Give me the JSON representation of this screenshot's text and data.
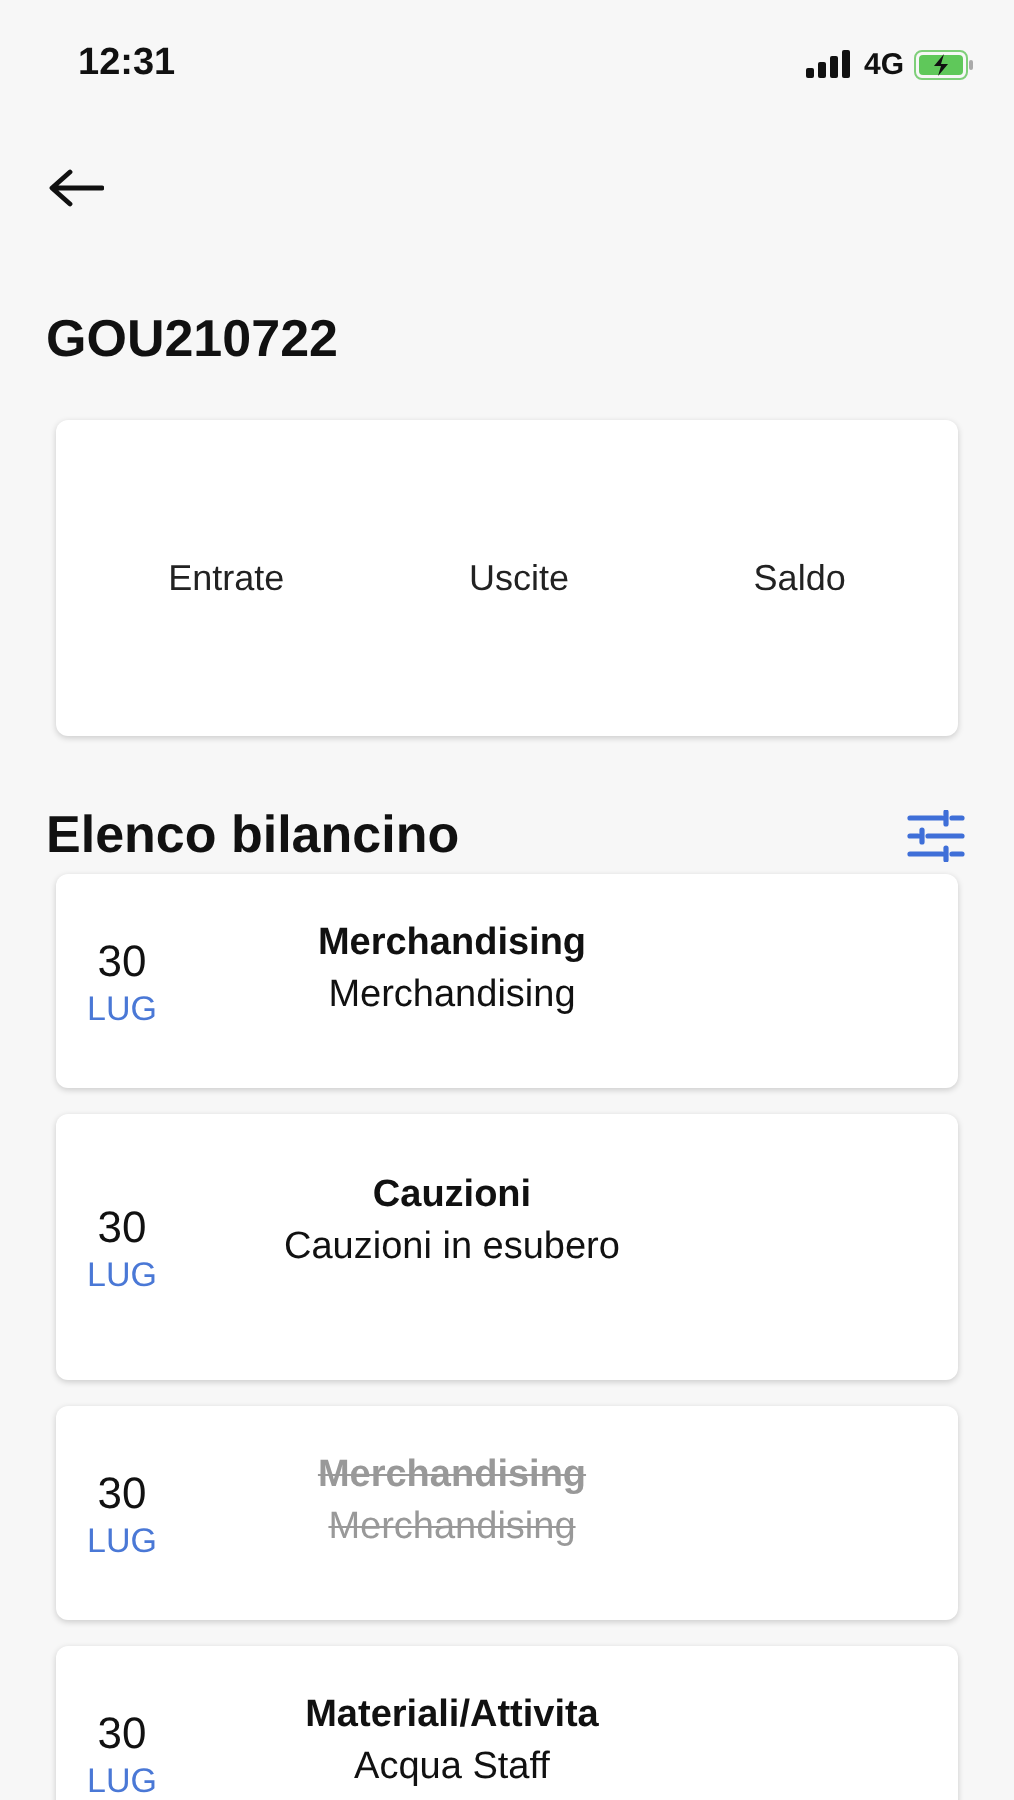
{
  "status_bar": {
    "time": "12:31",
    "network": "4G"
  },
  "title": "GOU210722",
  "summary": {
    "labels": [
      "Entrate",
      "Uscite",
      "Saldo"
    ]
  },
  "list": {
    "title": "Elenco bilancino",
    "items": [
      {
        "day": "30",
        "month": "LUG",
        "category": "Merchandising",
        "description": "Merchandising",
        "cancelled": false
      },
      {
        "day": "30",
        "month": "LUG",
        "category": "Cauzioni",
        "description": "Cauzioni in esubero",
        "cancelled": false
      },
      {
        "day": "30",
        "month": "LUG",
        "category": "Merchandising",
        "description": "Merchandising",
        "cancelled": true
      },
      {
        "day": "30",
        "month": "LUG",
        "category": "Materiali/Attivita",
        "description": "Acqua Staff",
        "cancelled": false
      }
    ]
  }
}
